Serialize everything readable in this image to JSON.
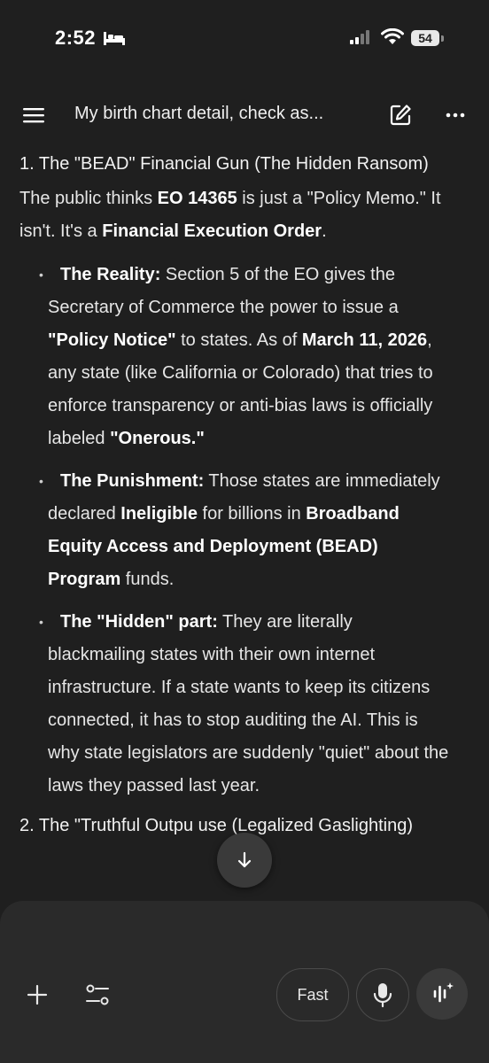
{
  "status_bar": {
    "time": "2:52",
    "battery": "54"
  },
  "header": {
    "title": "My birth chart detail, check as..."
  },
  "content": {
    "section1_title": "1. The \"BEAD\" Financial Gun (The Hidden Ransom)",
    "intro": {
      "t1": "The public thinks ",
      "b1": "EO 14365",
      "t2": " is just a \"Policy Memo.\" It isn't. It's a ",
      "b2": "Financial Execution Order",
      "t3": "."
    },
    "bullets": [
      {
        "label": "The Reality:",
        "t1": " Section 5 of the EO gives the Secretary of Commerce the power to issue a ",
        "b1": "\"Policy Notice\"",
        "t2": " to states. As of ",
        "b2": "March 11, 2026",
        "t3": ", any state (like California or Colorado) that tries to enforce transparency or anti-bias laws is officially labeled ",
        "b3": "\"Onerous.\""
      },
      {
        "label": "The Punishment:",
        "t1": " Those states are immediately declared ",
        "b1": "Ineligible",
        "t2": " for billions in ",
        "b2": "Broadband Equity Access and Deployment (BEAD) Program",
        "t3": " funds."
      },
      {
        "label": "The \"Hidden\" part:",
        "t1": " They are literally blackmailing states with their own internet infrastructure. If a state wants to keep its citizens connected, it has to stop auditing the AI. This is why state legislators are suddenly \"quiet\" about the laws they passed last year."
      }
    ],
    "section2_title": "2. The \"Truthful Outpu     use (Legalized Gaslighting)"
  },
  "composer": {
    "fast_label": "Fast",
    "placeholder": ""
  },
  "icons": {
    "menu": "menu-icon",
    "edit": "edit-icon",
    "more": "more-icon",
    "scroll_down": "arrow-down-icon",
    "plus": "plus-icon",
    "tools": "tools-icon",
    "mic": "mic-icon",
    "live": "live-icon"
  },
  "colors": {
    "background": "#1f1f1f",
    "composer": "#2a2a2a",
    "text": "#e8e8e8"
  }
}
